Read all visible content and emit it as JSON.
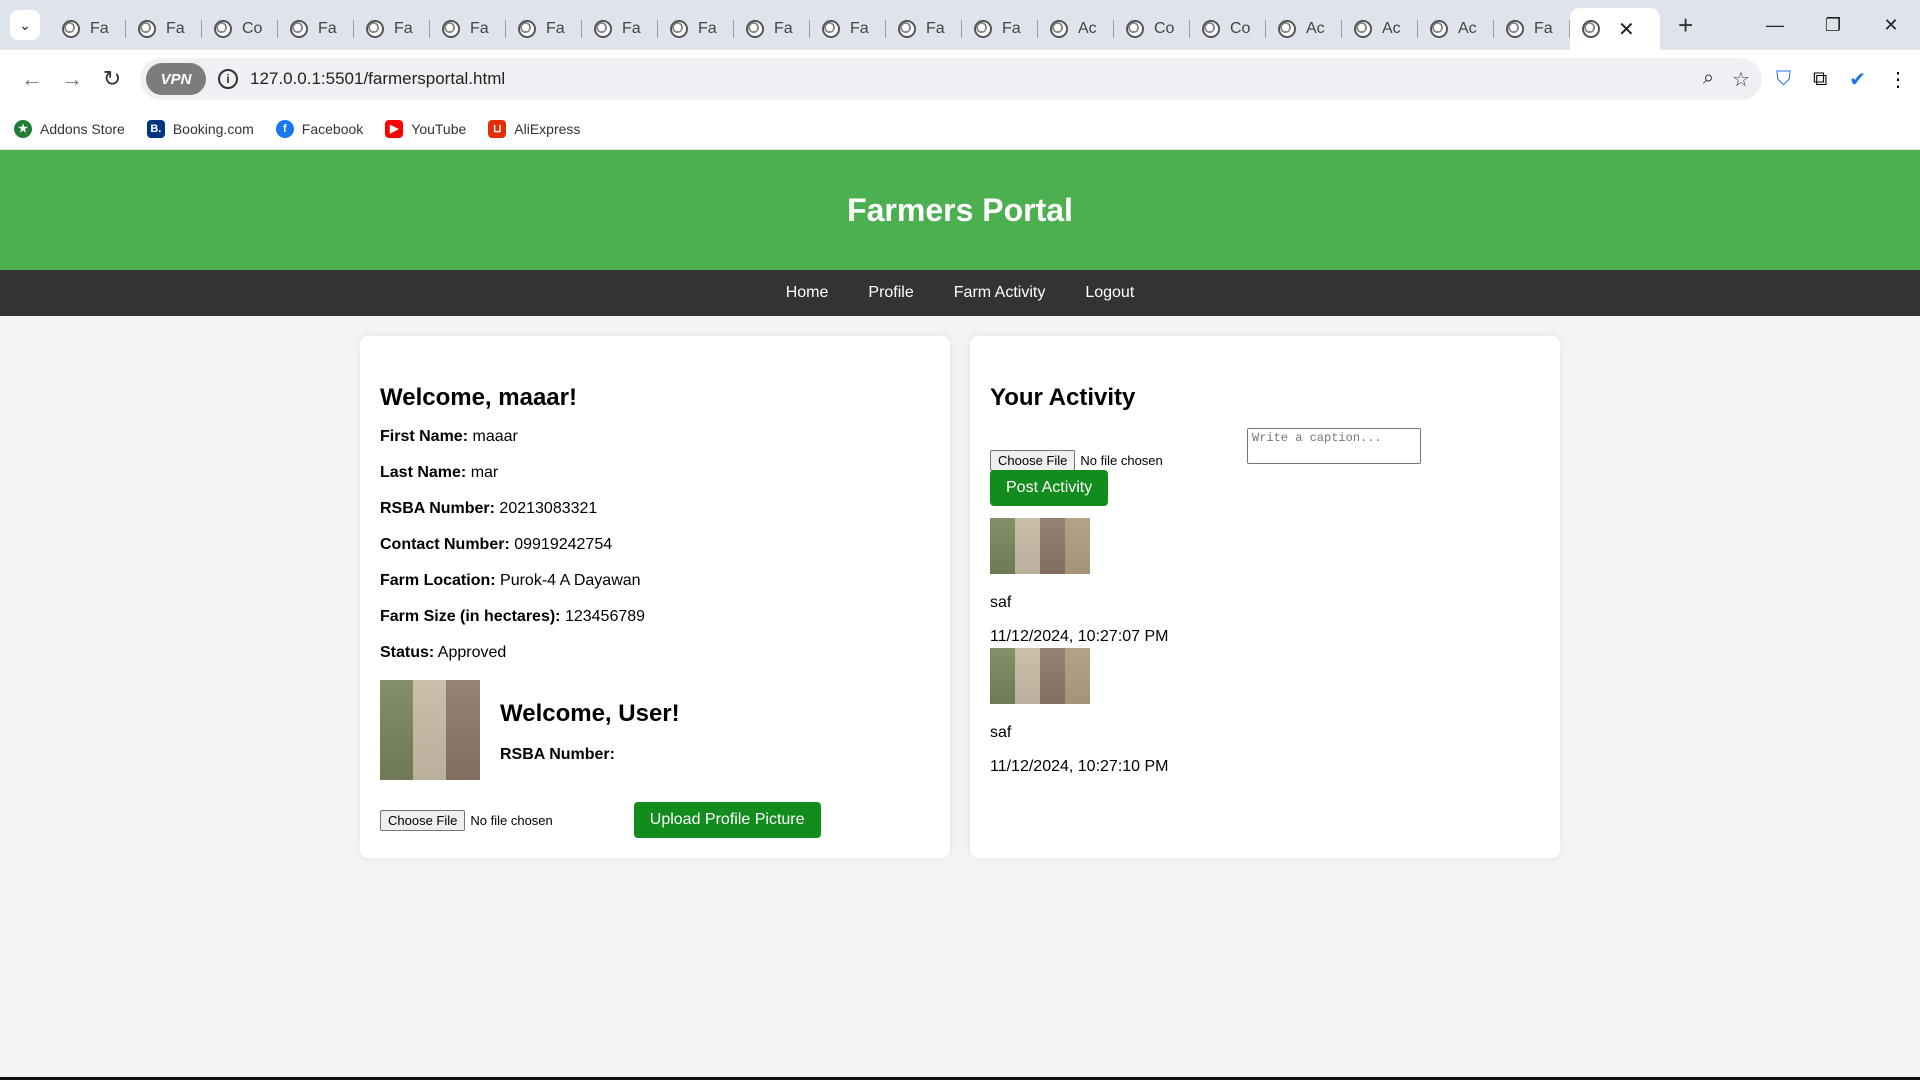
{
  "browser": {
    "tabs": [
      "Fa",
      "Fa",
      "Co",
      "Fa",
      "Fa",
      "Fa",
      "Fa",
      "Fa",
      "Fa",
      "Fa",
      "Fa",
      "Fa",
      "Fa",
      "Ac",
      "Co",
      "Co",
      "Ac",
      "Ac",
      "Ac",
      "Fa",
      ""
    ],
    "url": "127.0.0.1:5501/farmersportal.html",
    "vpn_label": "VPN",
    "bookmarks": [
      {
        "label": "Addons Store",
        "color": "#1e7e34"
      },
      {
        "label": "Booking.com",
        "color": "#003580"
      },
      {
        "label": "Facebook",
        "color": "#1877f2"
      },
      {
        "label": "YouTube",
        "color": "#ff0000"
      },
      {
        "label": "AliExpress",
        "color": "#e62e04"
      }
    ]
  },
  "header": {
    "title": "Farmers Portal"
  },
  "nav": {
    "home": "Home",
    "profile": "Profile",
    "farm_activity": "Farm Activity",
    "logout": "Logout"
  },
  "profile_card": {
    "welcome": "Welcome, maaar!",
    "fields": [
      {
        "label": "First Name:",
        "value": "maaar"
      },
      {
        "label": "Last Name:",
        "value": "mar"
      },
      {
        "label": "RSBA Number:",
        "value": "20213083321"
      },
      {
        "label": "Contact Number:",
        "value": "09919242754"
      },
      {
        "label": "Farm Location:",
        "value": "Purok-4 A Dayawan"
      },
      {
        "label": "Farm Size (in hectares):",
        "value": "123456789"
      },
      {
        "label": "Status:",
        "value": "Approved"
      }
    ],
    "user_welcome": "Welcome, User!",
    "user_rsba_label": "RSBA Number:",
    "choose_file": "Choose File",
    "no_file": "No file chosen",
    "upload_button": "Upload Profile Picture"
  },
  "activity_card": {
    "title": "Your Activity",
    "caption_placeholder": "Write a caption...",
    "choose_file": "Choose File",
    "no_file": "No file chosen",
    "post_button": "Post Activity",
    "posts": [
      {
        "caption": "saf",
        "time": "11/12/2024, 10:27:07 PM"
      },
      {
        "caption": "saf",
        "time": "11/12/2024, 10:27:10 PM"
      }
    ]
  },
  "colors": {
    "header_green": "#4caf50",
    "nav_dark": "#333333",
    "button_green": "#128c1c"
  }
}
